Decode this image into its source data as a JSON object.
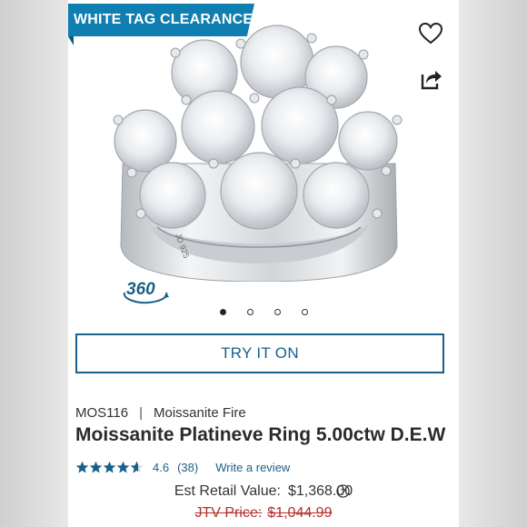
{
  "badge": {
    "text": "WHITE TAG CLEARANCE"
  },
  "actions": {
    "favorite_icon": "heart-icon",
    "share_icon": "share-icon"
  },
  "gallery": {
    "view360_label": "360",
    "dot_count": 4,
    "active_index": 0
  },
  "try_on": {
    "label": "TRY IT ON"
  },
  "product": {
    "sku": "MOS116",
    "separator": "|",
    "brand": "Moissanite Fire",
    "title": "Moissanite Platineve Ring 5.00ctw D.E.W",
    "rating_value": 4.6,
    "rating_text": "4.6",
    "review_count": "(38)",
    "write_review": "Write a review"
  },
  "pricing": {
    "retail_label": "Est Retail Value:",
    "retail_value": "$1,368.00",
    "jtv_label": "JTV Price:",
    "jtv_value": "$1,044.99"
  },
  "colors": {
    "brand_blue": "#0f7eb0",
    "link_blue": "#1c5f86",
    "strike_red": "#b3302d"
  }
}
